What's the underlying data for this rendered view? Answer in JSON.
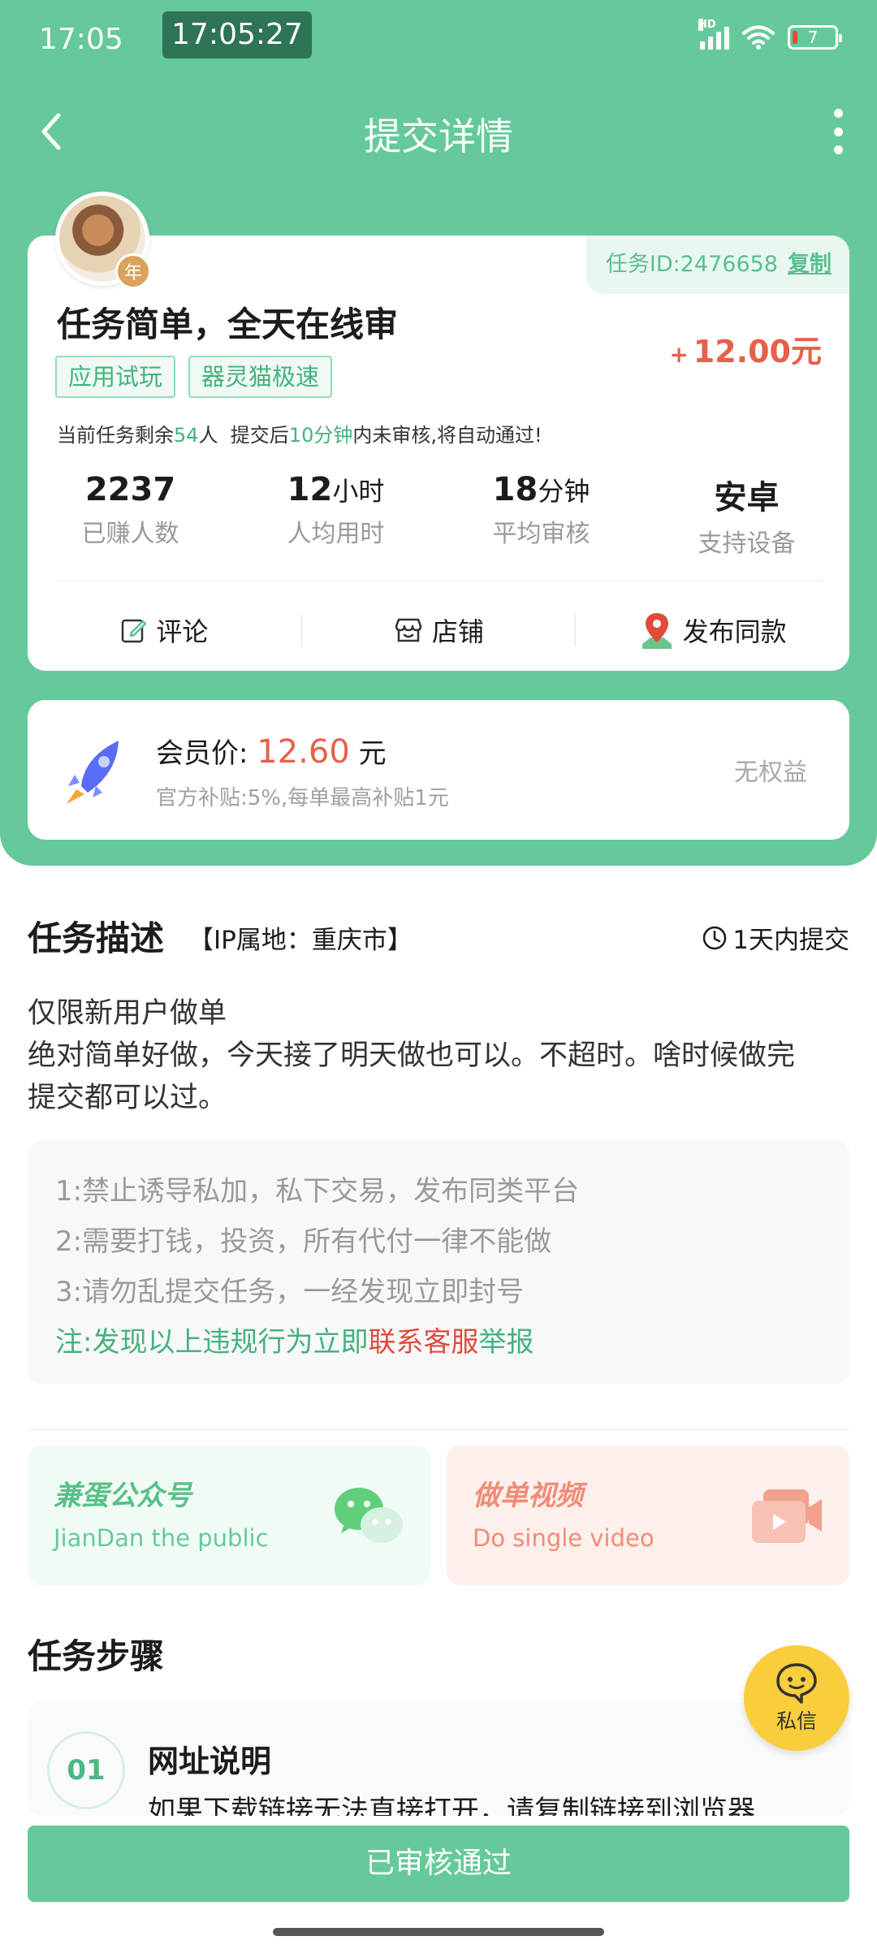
{
  "status_bar": {
    "time": "17:05",
    "timer": "17:05:27",
    "network": "HD",
    "battery": "7"
  },
  "nav": {
    "title": "提交详情"
  },
  "task": {
    "avatar_badge": "年",
    "id_label": "任务ID:2476658",
    "copy_label": "复制",
    "title": "任务简单，全天在线审",
    "price_sign": "+",
    "price": "12.00元",
    "tags": [
      "应用试玩",
      "器灵猫极速"
    ],
    "notice": {
      "prefix": "当前任务剩余",
      "remaining": "54",
      "mid": "人  提交后",
      "minutes": "10分钟",
      "suffix": "内未审核,将自动通过!"
    },
    "stats": [
      {
        "value": "2237",
        "unit": "",
        "label": "已赚人数"
      },
      {
        "value": "12",
        "unit": "小时",
        "label": "人均用时"
      },
      {
        "value": "18",
        "unit": "分钟",
        "label": "平均审核"
      },
      {
        "value": "安卓",
        "unit": "",
        "label": "支持设备"
      }
    ],
    "actions": {
      "comment": "评论",
      "shop": "店铺",
      "publish": "发布同款"
    }
  },
  "vip": {
    "label": "会员价:",
    "price": "12.60",
    "unit": "元",
    "sub": "官方补贴:5%,每单最高补贴1元",
    "right": "无权益"
  },
  "description": {
    "title": "任务描述",
    "ip": "【IP属地：重庆市】",
    "deadline": "1天内提交",
    "lines": [
      "仅限新用户做单",
      "绝对简单好做，今天接了明天做也可以。不超时。啥时候做完",
      "提交都可以过。"
    ],
    "rules": [
      "1:禁止诱导私加，私下交易，发布同类平台",
      "2:需要打钱，投资，所有代付一律不能做",
      "3:请勿乱提交任务，一经发现立即封号"
    ],
    "note_prefix": "注:发现以上违规行为立即",
    "note_link": "联系客服",
    "note_suffix": "举报"
  },
  "promos": [
    {
      "title": "兼蛋公众号",
      "subtitle": "JianDan the public"
    },
    {
      "title": "做单视频",
      "subtitle": "Do single video"
    }
  ],
  "steps": {
    "title": "任务步骤",
    "items": [
      {
        "num": "01",
        "title": "网址说明",
        "text": "如果下载链接无法直接打开，请复制链接到浏览器"
      }
    ]
  },
  "fab": {
    "label": "私信"
  },
  "submit": {
    "label": "已审核通过"
  },
  "colors": {
    "primary": "#66c99b",
    "price": "#e8604a",
    "fab": "#f9cd3c"
  }
}
